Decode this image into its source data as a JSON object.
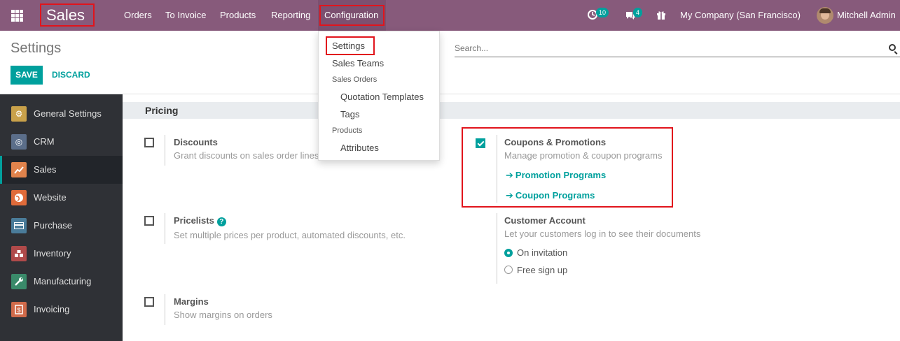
{
  "topbar": {
    "brand": "Sales",
    "menu": [
      "Orders",
      "To Invoice",
      "Products",
      "Reporting",
      "Configuration"
    ],
    "activities_count": "10",
    "messages_count": "4",
    "company": "My Company (San Francisco)",
    "user": "Mitchell Admin"
  },
  "control_panel": {
    "title": "Settings",
    "save_label": "SAVE",
    "discard_label": "DISCARD",
    "search_placeholder": "Search..."
  },
  "dropdown": {
    "settings": "Settings",
    "sales_teams": "Sales Teams",
    "sales_orders_header": "Sales Orders",
    "quotation_templates": "Quotation Templates",
    "tags": "Tags",
    "products_header": "Products",
    "attributes": "Attributes"
  },
  "sidebar": {
    "items": [
      {
        "label": "General Settings",
        "icon": "gear-icon",
        "color": "#c9a14a"
      },
      {
        "label": "CRM",
        "icon": "handshake-icon",
        "color": "#5b6e8a"
      },
      {
        "label": "Sales",
        "icon": "chart-icon",
        "color": "#e0834c"
      },
      {
        "label": "Website",
        "icon": "globe-icon",
        "color": "#e06b3a"
      },
      {
        "label": "Purchase",
        "icon": "card-icon",
        "color": "#4a7c9a"
      },
      {
        "label": "Inventory",
        "icon": "boxes-icon",
        "color": "#b04a4a"
      },
      {
        "label": "Manufacturing",
        "icon": "wrench-icon",
        "color": "#3a8a6a"
      },
      {
        "label": "Invoicing",
        "icon": "invoice-icon",
        "color": "#d06a4a"
      }
    ]
  },
  "main": {
    "section_title": "Pricing",
    "discounts": {
      "title": "Discounts",
      "desc": "Grant discounts on sales order lines",
      "checked": false
    },
    "coupons": {
      "title": "Coupons & Promotions",
      "desc": "Manage promotion & coupon programs",
      "checked": true,
      "link1": "Promotion Programs",
      "link2": "Coupon Programs"
    },
    "pricelists": {
      "title": "Pricelists",
      "desc": "Set multiple prices per product, automated discounts, etc.",
      "checked": false
    },
    "customer_account": {
      "title": "Customer Account",
      "desc": "Let your customers log in to see their documents",
      "options": [
        "On invitation",
        "Free sign up"
      ],
      "selected": "On invitation"
    },
    "margins": {
      "title": "Margins",
      "desc": "Show margins on orders",
      "checked": false
    }
  },
  "colors": {
    "brand": "#875a7b",
    "accent": "#00a09d",
    "highlight": "#e1141c"
  }
}
